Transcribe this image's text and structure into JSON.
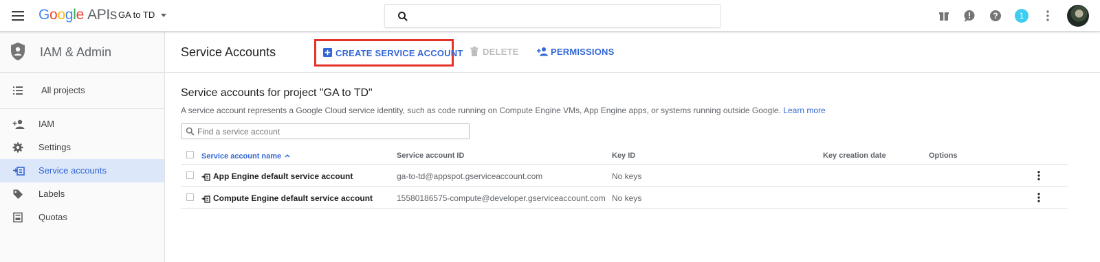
{
  "topbar": {
    "logo_google": [
      "G",
      "o",
      "o",
      "g",
      "l",
      "e"
    ],
    "logo_apis": "APIs",
    "project_name": "GA to TD",
    "search_placeholder": "",
    "notification_count": "1"
  },
  "sidebar": {
    "title": "IAM & Admin",
    "all_projects": "All projects",
    "items": [
      {
        "label": "IAM",
        "icon": "person-add-icon"
      },
      {
        "label": "Settings",
        "icon": "gear-icon"
      },
      {
        "label": "Service accounts",
        "icon": "service-account-icon",
        "active": true
      },
      {
        "label": "Labels",
        "icon": "label-tag-icon"
      },
      {
        "label": "Quotas",
        "icon": "quota-icon"
      }
    ]
  },
  "actionbar": {
    "page_title": "Service Accounts",
    "create_label": "CREATE SERVICE ACCOUNT",
    "delete_label": "DELETE",
    "permissions_label": "PERMISSIONS"
  },
  "content": {
    "section_title": "Service accounts for project \"GA to TD\"",
    "description": "A service account represents a Google Cloud service identity, such as code running on Compute Engine VMs, App Engine apps, or systems running outside Google.",
    "learn_more": "Learn more",
    "filter_placeholder": "Find a service account"
  },
  "table": {
    "headers": {
      "name": "Service account name",
      "id": "Service account ID",
      "key_id": "Key ID",
      "key_date": "Key creation date",
      "options": "Options"
    },
    "rows": [
      {
        "name": "App Engine default service account",
        "id": "ga-to-td@appspot.gserviceaccount.com",
        "key_id": "No keys",
        "key_date": ""
      },
      {
        "name": "Compute Engine default service account",
        "id": "15580186575-compute@developer.gserviceaccount.com",
        "key_id": "No keys",
        "key_date": ""
      }
    ]
  },
  "colors": {
    "accent_blue": "#3367d6",
    "highlight_red": "#e53229",
    "active_bg": "#dce7fa"
  }
}
